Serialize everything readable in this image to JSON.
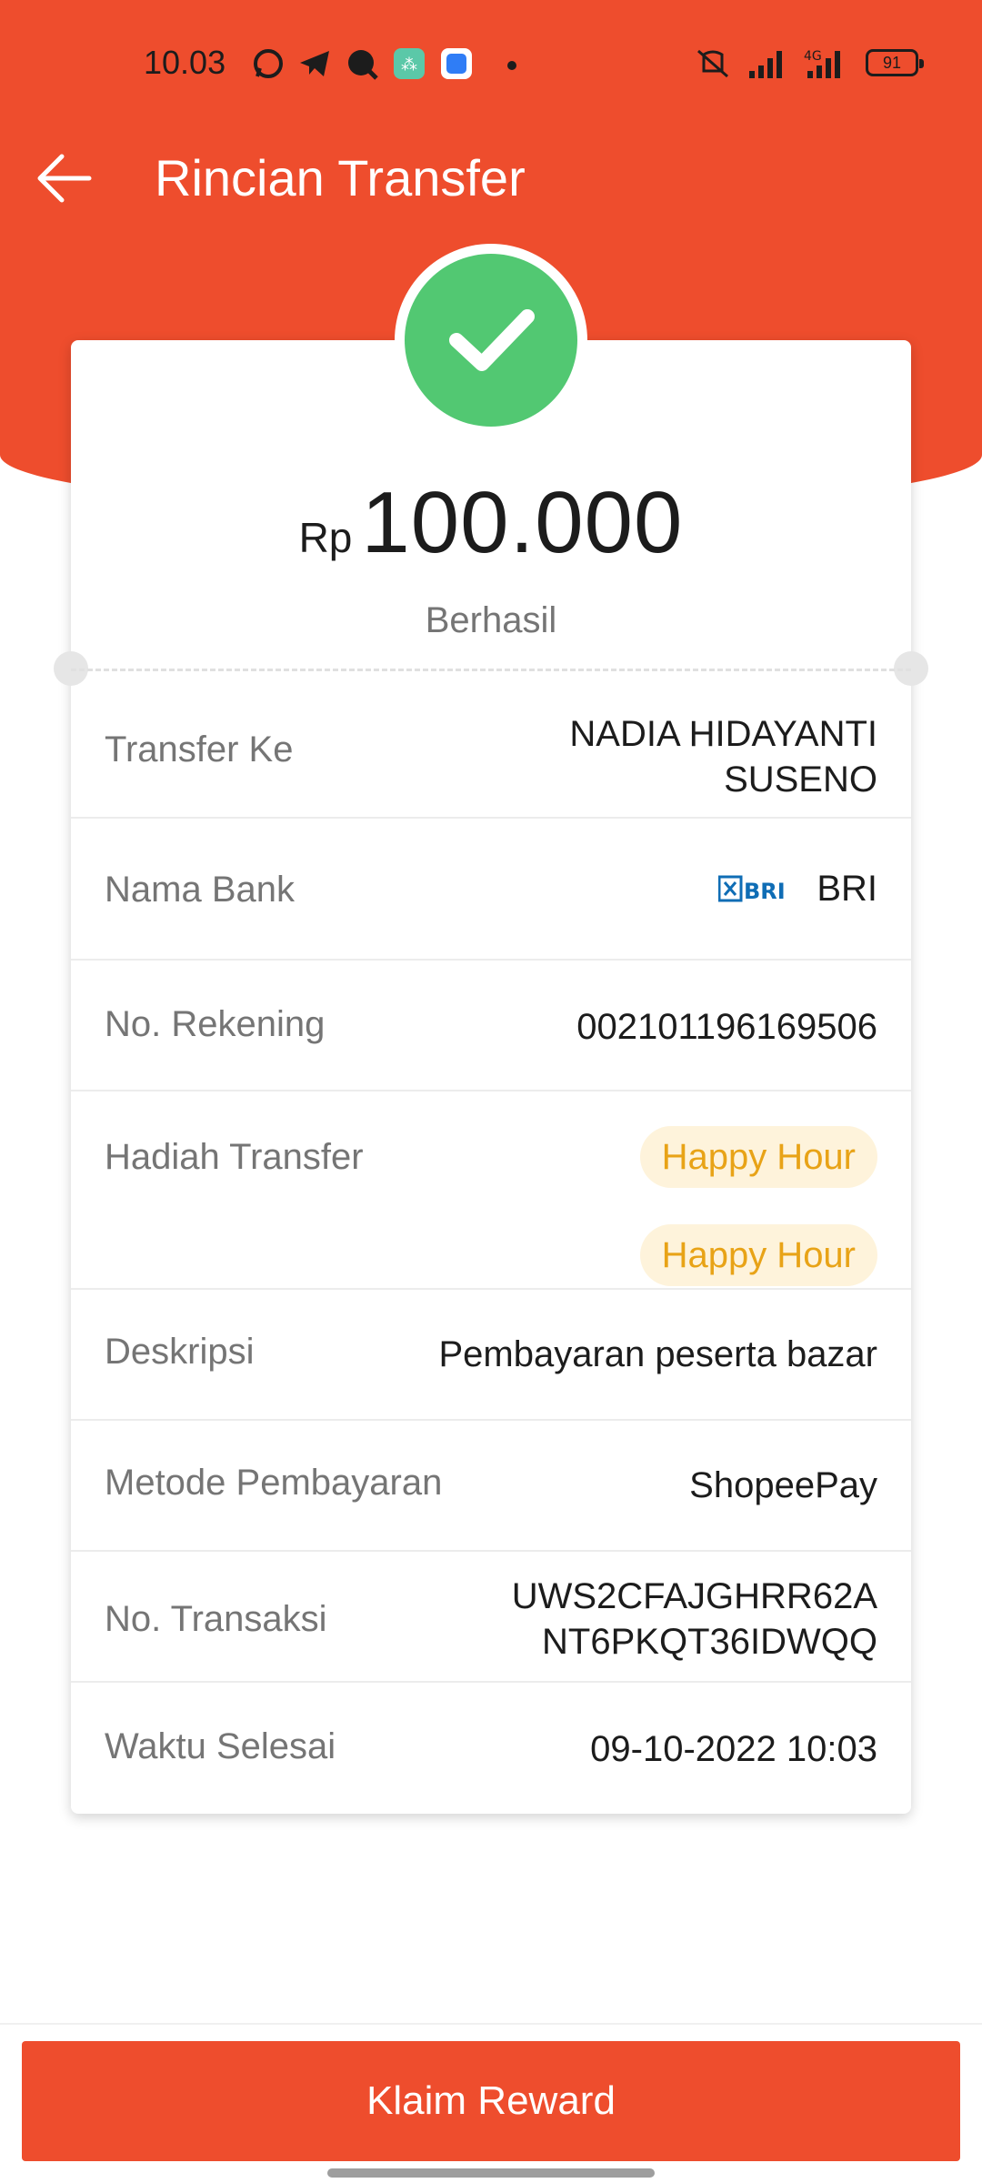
{
  "status_bar": {
    "time": "10.03",
    "battery": "91",
    "network": "4G"
  },
  "header": {
    "title": "Rincian Transfer",
    "back_icon": "arrow-left-icon"
  },
  "colors": {
    "brand": "#EE4D2D",
    "success": "#52C872",
    "badge_bg": "#FEF3DB",
    "badge_text": "#E8A317"
  },
  "summary": {
    "currency": "Rp",
    "amount": "100.000",
    "status": "Berhasil"
  },
  "details": {
    "transfer_to": {
      "label": "Transfer Ke",
      "value_line1": "NADIA HIDAYANTI",
      "value_line2": "SUSENO"
    },
    "bank_name": {
      "label": "Nama Bank",
      "logo_text": "BRI",
      "value": "BRI"
    },
    "account_number": {
      "label": "No. Rekening",
      "value": "002101196169506"
    },
    "transfer_reward": {
      "label": "Hadiah Transfer",
      "badges": [
        "Happy Hour",
        "Happy Hour"
      ]
    },
    "description": {
      "label": "Deskripsi",
      "value": "Pembayaran peserta bazar"
    },
    "payment_method": {
      "label": "Metode Pembayaran",
      "value": "ShopeePay"
    },
    "transaction_no": {
      "label": "No. Transaksi",
      "value_line1": "UWS2CFAJGHRR62A",
      "value_line2": "NT6PKQT36IDWQQ"
    },
    "completed_time": {
      "label": "Waktu Selesai",
      "value": "09-10-2022 10:03"
    }
  },
  "footer": {
    "button_label": "Klaim Reward"
  }
}
